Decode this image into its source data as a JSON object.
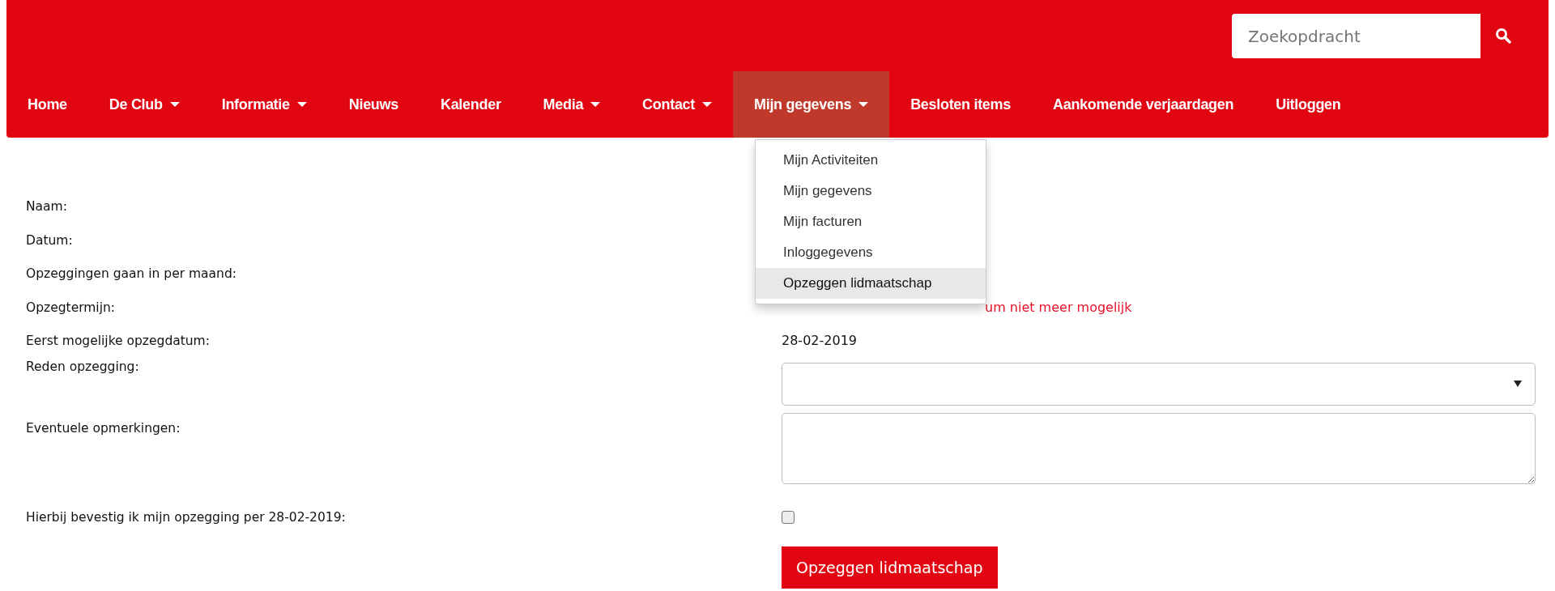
{
  "search": {
    "placeholder": "Zoekopdracht"
  },
  "nav": [
    {
      "label": "Home",
      "dropdown": false,
      "selected": false
    },
    {
      "label": "De Club",
      "dropdown": true,
      "selected": false
    },
    {
      "label": "Informatie",
      "dropdown": true,
      "selected": false
    },
    {
      "label": "Nieuws",
      "dropdown": false,
      "selected": false
    },
    {
      "label": "Kalender",
      "dropdown": false,
      "selected": false
    },
    {
      "label": "Media",
      "dropdown": true,
      "selected": false
    },
    {
      "label": "Contact",
      "dropdown": true,
      "selected": false
    },
    {
      "label": "Mijn gegevens",
      "dropdown": true,
      "selected": true
    },
    {
      "label": "Besloten items",
      "dropdown": false,
      "selected": false
    },
    {
      "label": "Aankomende verjaardagen",
      "dropdown": false,
      "selected": false
    },
    {
      "label": "Uitloggen",
      "dropdown": false,
      "selected": false
    }
  ],
  "dropdown_menu": [
    {
      "label": "Mijn Activiteiten",
      "selected": false
    },
    {
      "label": "Mijn gegevens",
      "selected": false
    },
    {
      "label": "Mijn facturen",
      "selected": false
    },
    {
      "label": "Inloggegevens",
      "selected": false
    },
    {
      "label": "Opzeggen lidmaatschap",
      "selected": true
    }
  ],
  "form": {
    "rows": [
      {
        "kind": "text",
        "label": "Naam:"
      },
      {
        "kind": "text",
        "label": "Datum:"
      },
      {
        "kind": "text",
        "label": "Opzeggingen gaan in per maand:"
      },
      {
        "kind": "warning",
        "label": "Opzegtermijn:",
        "value": "um niet meer mogelijk"
      },
      {
        "kind": "text",
        "label": "Eerst mogelijke opzegdatum:",
        "value": "28-02-2019"
      },
      {
        "kind": "select",
        "label": "Reden opzegging:"
      },
      {
        "kind": "textarea",
        "label": "Eventuele opmerkingen:"
      },
      {
        "kind": "checkbox",
        "label": "Hierbij bevestig ik mijn opzegging per 28-02-2019:",
        "checked": false
      }
    ],
    "submit": "Opzeggen lidmaatschap"
  }
}
